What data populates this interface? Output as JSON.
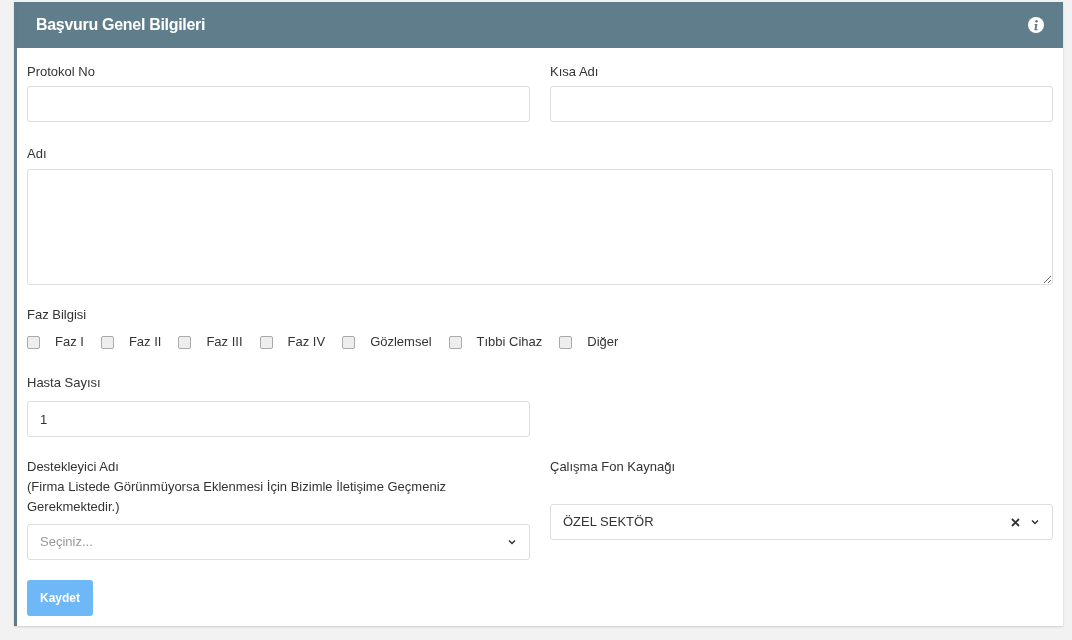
{
  "panel": {
    "title": "Başvuru Genel Bilgileri"
  },
  "fields": {
    "protocol_no": {
      "label": "Protokol No"
    },
    "short_name": {
      "label": "Kısa Adı"
    },
    "name": {
      "label": "Adı"
    }
  },
  "phase": {
    "label": "Faz Bilgisi",
    "options": [
      {
        "label": "Faz I",
        "checked": false
      },
      {
        "label": "Faz II",
        "checked": false
      },
      {
        "label": "Faz III",
        "checked": false
      },
      {
        "label": "Faz IV",
        "checked": false
      },
      {
        "label": "Gözlemsel",
        "checked": false
      },
      {
        "label": "Tıbbi Cihaz",
        "checked": false
      },
      {
        "label": "Diğer",
        "checked": false
      }
    ]
  },
  "patient_count": {
    "label": "Hasta Sayısı",
    "value": "1"
  },
  "sponsor": {
    "label": "Destekleyici Adı",
    "note": "(Firma Listede Görünmüyorsa Eklenmesi İçin Bizimle İletişime Geçmeniz Gerekmektedir.)",
    "placeholder": "Seçiniz..."
  },
  "funding": {
    "label": "Çalışma Fon Kaynağı",
    "value": "ÖZEL SEKTÖR"
  },
  "save_button": {
    "label": "Kaydet",
    "disabled": true
  }
}
